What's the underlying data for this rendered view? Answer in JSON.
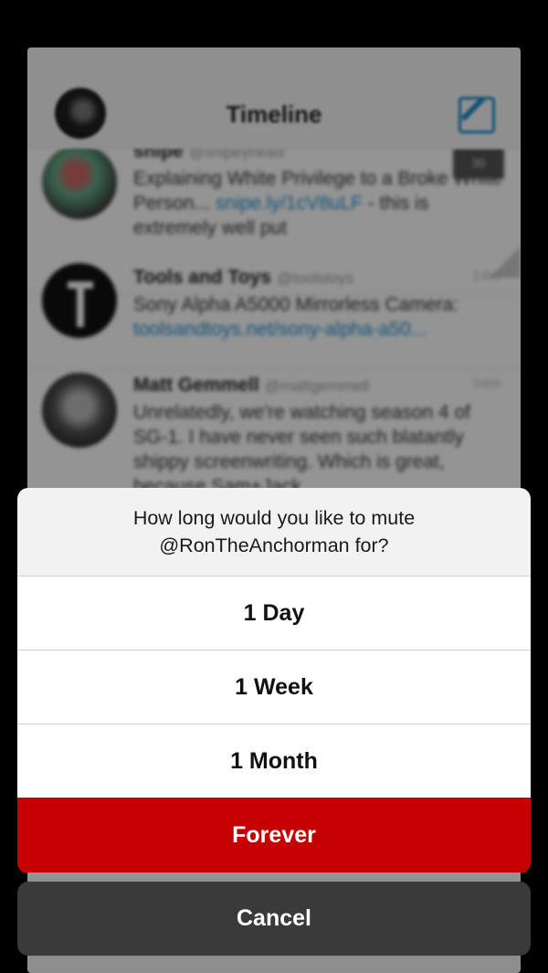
{
  "header": {
    "title": "Timeline"
  },
  "timeline": [
    {
      "name": "snipe",
      "handle": "@snipeyhead",
      "text": "Explaining White Privilege to a Broke White Person...",
      "link": "snipe.ly/1cV8uLF",
      "text2": " - this is extremely well put",
      "badge": "30"
    },
    {
      "name": "Tools and Toys",
      "handle": "@toolstoys",
      "text": "Sony Alpha A5000 Mirrorless Camera:",
      "link": "toolsandtoys.net/sony-alpha-a50...",
      "time": "14m"
    },
    {
      "name": "Matt Gemmell",
      "handle": "@mattgemmell",
      "text": "Unrelatedly, we're watching season 4 of SG-1. I have never seen such blatantly shippy screenwriting. Which is great, because Sam+Jack",
      "time": "34m"
    }
  ],
  "mute_sheet": {
    "message": "How long would you like to mute\n@RonTheAnchorman for?",
    "options": [
      "1 Day",
      "1 Week",
      "1 Month",
      "Forever"
    ],
    "cancel_label": "Cancel"
  },
  "colors": {
    "accent": "#1e8ccf",
    "danger": "#c60000"
  }
}
